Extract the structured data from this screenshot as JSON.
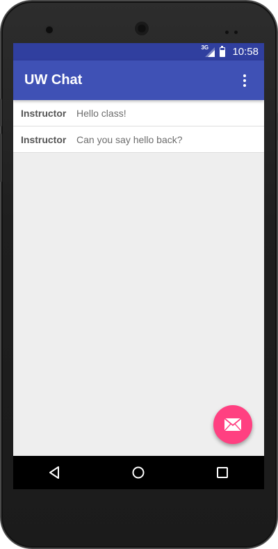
{
  "status_bar": {
    "network_label": "3G",
    "battery_level": 0.7,
    "time": "10:58",
    "color": "#303f9f"
  },
  "app_bar": {
    "title": "UW Chat",
    "menu_icon": "overflow-menu-icon",
    "color": "#3f51b5"
  },
  "messages": [
    {
      "author": "Instructor",
      "text": "Hello class!"
    },
    {
      "author": "Instructor",
      "text": "Can you say hello back?"
    }
  ],
  "fab": {
    "icon": "envelope-icon",
    "color": "#ff4081"
  },
  "navigation": {
    "back_icon": "back-icon",
    "home_icon": "home-icon",
    "recents_icon": "recents-icon"
  }
}
